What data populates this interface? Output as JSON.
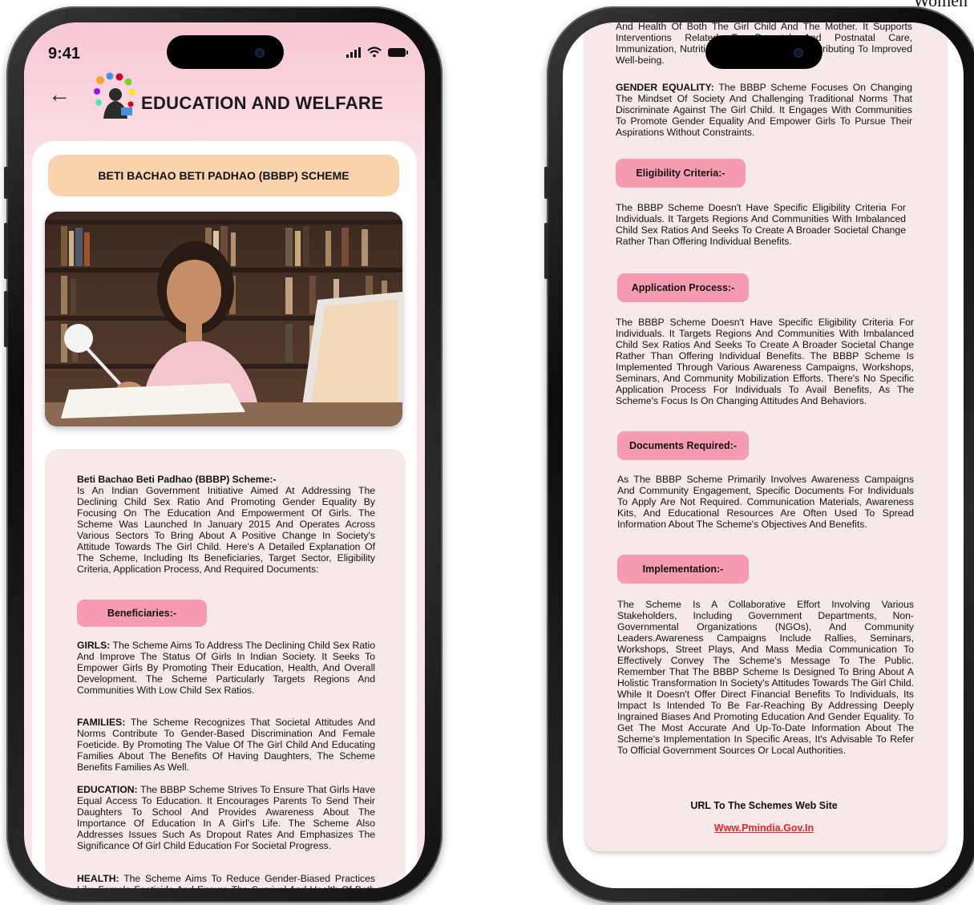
{
  "corner_text": "Women",
  "left": {
    "status": {
      "time": "9:41"
    },
    "header": {
      "title": "EDUCATION AND WELFARE"
    },
    "scheme_title": "BETI BACHAO BETI PADHAO (BBBP) SCHEME",
    "intro": {
      "heading": "Beti Bachao Beti Padhao (BBBP) Scheme:-",
      "text": "Is An Indian Government Initiative Aimed At Addressing The Declining Child Sex Ratio And Promoting Gender Equality By Focusing On The Education And Empowerment Of Girls. The Scheme Was Launched In January 2015 And Operates Across Various Sectors To Bring About A Positive Change In Society's Attitude Towards The Girl Child. Here's A Detailed Explanation Of The Scheme, Including Its Beneficiaries, Target Sector, Eligibility Criteria, Application Process, And Required Documents:"
    },
    "beneficiaries_label": "Beneficiaries:-",
    "girls": {
      "label": "GIRLS:",
      "text": "The Scheme Aims To Address The Declining Child Sex Ratio And Improve The Status Of Girls In Indian Society. It Seeks To Empower Girls By Promoting Their Education, Health, And Overall Development. The Scheme Particularly Targets Regions And Communities With Low Child Sex Ratios."
    },
    "families": {
      "label": "FAMILIES:",
      "text": "The Scheme Recognizes That Societal Attitudes And Norms Contribute To Gender-Based Discrimination And Female Foeticide. By Promoting The Value Of The Girl Child And Educating Families About The Benefits Of Having Daughters, The Scheme Benefits Families As Well."
    },
    "education": {
      "label": "EDUCATION:",
      "text": "The BBBP Scheme Strives To Ensure That Girls Have Equal Access To Education. It Encourages Parents To Send Their Daughters To School And Provides Awareness About The Importance Of Education In A Girl's Life. The Scheme Also Addresses Issues Such As Dropout Rates And Emphasizes The Significance Of Girl Child Education For Societal Progress."
    },
    "health": {
      "label": "HEALTH:",
      "text": "The Scheme Aims To Reduce Gender-Biased Practices Like Female Foeticide And Ensure The Survival And Health Of Both The Girl Child And The Mother."
    }
  },
  "right": {
    "health_cont": "And Health Of Both The Girl Child And The Mother. It Supports Interventions Related To Prenatal And Postnatal Care, Immunization, Nutrition, And Health, Thus Contributing To Improved Well-being.",
    "gender": {
      "label": "GENDER EQUALITY:",
      "text": "The BBBP Scheme Focuses On Changing The Mindset Of Society And Challenging Traditional Norms That Discriminate Against The Girl Child. It Engages With Communities To Promote Gender Equality And Empower Girls To Pursue Their Aspirations Without Constraints."
    },
    "eligibility": {
      "label": "Eligibility Criteria:-",
      "text": "The BBBP Scheme Doesn't Have Specific Eligibility Criteria For Individuals. It Targets Regions And Communities With Imbalanced Child Sex Ratios And Seeks To Create A Broader Societal Change Rather Than Offering Individual Benefits."
    },
    "application": {
      "label": "Application Process:-",
      "text": "The BBBP Scheme Doesn't Have Specific Eligibility Criteria For Individuals. It Targets Regions And Communities With Imbalanced Child Sex Ratios And Seeks To Create A Broader Societal Change Rather Than Offering Individual Benefits. The BBBP Scheme Is Implemented Through Various Awareness Campaigns, Workshops, Seminars, And Community Mobilization Efforts. There's No Specific Application Process For Individuals To Avail Benefits, As The Scheme's Focus Is On Changing Attitudes And Behaviors."
    },
    "documents": {
      "label": "Documents Required:-",
      "text": "As The BBBP Scheme Primarily Involves Awareness Campaigns And Community Engagement, Specific Documents For Individuals To Apply Are Not Required. Communication Materials, Awareness Kits, And Educational Resources Are Often Used To Spread Information About The Scheme's Objectives And Benefits."
    },
    "implementation": {
      "label": "Implementation:-",
      "text": "The Scheme Is A Collaborative Effort Involving Various Stakeholders, Including Government Departments, Non-Governmental Organizations (NGOs), And Community Leaders.Awareness Campaigns Include Rallies, Seminars, Workshops, Street Plays, And Mass Media Communication To Effectively Convey The Scheme's Message To The Public. Remember That The BBBP Scheme Is Designed To Bring About A Holistic Transformation In Society's Attitudes Towards The Girl Child. While It Doesn't Offer Direct Financial Benefits To Individuals, Its Impact Is Intended To Be Far-Reaching By Addressing Deeply Ingrained Biases And Promoting Education And Gender Equality. To Get The Most Accurate And Up-To-Date Information About The Scheme's Implementation In Specific Areas, It's Advisable To Refer To Official Government Sources Or Local Authorities."
    },
    "url_label": "URL To The Schemes Web Site",
    "url_link": "Www.Pmindia.Gov.In"
  },
  "icons": [
    "back-arrow-icon",
    "signal-icon",
    "wifi-icon",
    "battery-icon",
    "education-welfare-logo"
  ],
  "colors": {
    "header_pink": "#f7c7d5",
    "peach_pill": "#f9d3ac",
    "pink_pill": "#f79bb3",
    "card_bg": "#f7e9e9",
    "link_red": "#e3262b"
  }
}
